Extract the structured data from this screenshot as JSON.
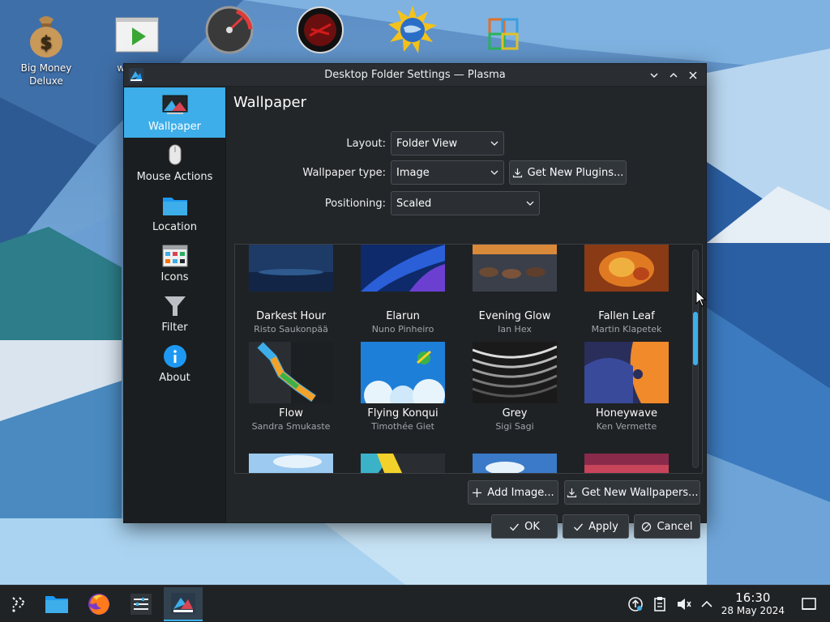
{
  "desktop": {
    "icons": [
      {
        "label": "Big Money Deluxe",
        "icon": "money-bag-icon"
      },
      {
        "label": "wh russi",
        "icon": "media-player-icon"
      },
      {
        "label": "",
        "icon": "speedometer-icon"
      },
      {
        "label": "",
        "icon": "red-disc-icon"
      },
      {
        "label": "",
        "icon": "sun-globe-icon"
      },
      {
        "label": "",
        "icon": "office-suite-icon"
      }
    ]
  },
  "window": {
    "title": "Desktop Folder Settings — Plasma",
    "controls": {
      "minimize": "⌄",
      "maximize": "⌃",
      "close": "✕"
    }
  },
  "sidebar": {
    "items": [
      {
        "label": "Wallpaper",
        "icon": "wallpaper-icon",
        "active": true
      },
      {
        "label": "Mouse Actions",
        "icon": "mouse-icon",
        "active": false
      },
      {
        "label": "Location",
        "icon": "folder-icon",
        "active": false
      },
      {
        "label": "Icons",
        "icon": "icons-icon",
        "active": false
      },
      {
        "label": "Filter",
        "icon": "filter-icon",
        "active": false
      },
      {
        "label": "About",
        "icon": "info-icon",
        "active": false
      }
    ]
  },
  "page": {
    "title": "Wallpaper",
    "layout": {
      "label": "Layout:",
      "value": "Folder View"
    },
    "wallpaper_type": {
      "label": "Wallpaper type:",
      "value": "Image"
    },
    "get_plugins": "Get New Plugins...",
    "positioning": {
      "label": "Positioning:",
      "value": "Scaled"
    }
  },
  "wallpapers": [
    {
      "name": "Darkest Hour",
      "author": "Risto Saukonpää"
    },
    {
      "name": "Elarun",
      "author": "Nuno Pinheiro"
    },
    {
      "name": "Evening Glow",
      "author": "Ian Hex"
    },
    {
      "name": "Fallen Leaf",
      "author": "Martin Klapetek"
    },
    {
      "name": "Flow",
      "author": "Sandra Smukaste"
    },
    {
      "name": "Flying Konqui",
      "author": "Timothée Giet"
    },
    {
      "name": "Grey",
      "author": "Sigi Sagi"
    },
    {
      "name": "Honeywave",
      "author": "Ken Vermette"
    }
  ],
  "actions": {
    "add_image": "Add Image...",
    "get_wallpapers": "Get New Wallpapers...",
    "ok": "OK",
    "apply": "Apply",
    "cancel": "Cancel"
  },
  "taskbar": {
    "launchers": [
      "app-launcher-icon",
      "file-manager-icon",
      "firefox-icon",
      "system-settings-icon",
      "plasma-dialog-icon"
    ],
    "tray": [
      "updates-icon",
      "clipboard-icon",
      "volume-muted-icon",
      "tray-expand-icon"
    ],
    "time": "16:30",
    "date": "28 May 2024"
  },
  "colors": {
    "accent": "#3daee9",
    "window_bg": "#232629",
    "sidebar_bg": "#1b1e20"
  }
}
